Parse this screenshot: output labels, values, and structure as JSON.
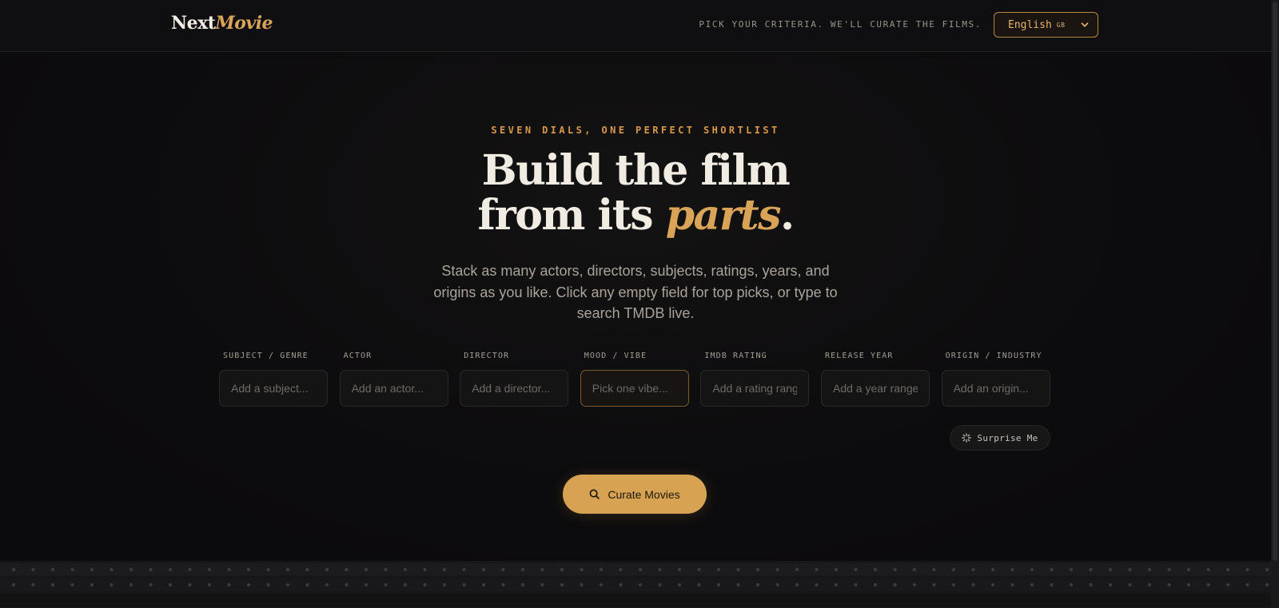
{
  "header": {
    "logo_main": "Next",
    "logo_accent": "Movie",
    "tagline": "PICK YOUR CRITERIA. WE'LL CURATE THE FILMS.",
    "language": {
      "selected": "English",
      "flag": "GB"
    }
  },
  "hero": {
    "eyebrow": "SEVEN DIALS, ONE PERFECT SHORTLIST",
    "headline_line1": "Build the film",
    "headline_line2_prefix": "from its ",
    "headline_accent": "parts",
    "headline_suffix": ".",
    "subtext": "Stack as many actors, directors, subjects, ratings, years, and origins as you like. Click any empty field for top picks, or type to search TMDB live."
  },
  "fields": [
    {
      "label": "SUBJECT / GENRE",
      "placeholder": "Add a subject...",
      "value": ""
    },
    {
      "label": "ACTOR",
      "placeholder": "Add an actor...",
      "value": ""
    },
    {
      "label": "DIRECTOR",
      "placeholder": "Add a director...",
      "value": ""
    },
    {
      "label": "MOOD / VIBE",
      "placeholder": "Pick one vibe...",
      "value": ""
    },
    {
      "label": "IMDB RATING",
      "placeholder": "Add a rating range...",
      "value": ""
    },
    {
      "label": "RELEASE YEAR",
      "placeholder": "Add a year range...",
      "value": ""
    },
    {
      "label": "ORIGIN / INDUSTRY",
      "placeholder": "Add an origin...",
      "value": ""
    }
  ],
  "actions": {
    "surprise_label": "Surprise Me",
    "curate_label": "Curate Movies"
  },
  "colors": {
    "accent": "#d9a457",
    "background": "#0c0b0d",
    "eyebrow": "#d9984a"
  },
  "icons": {
    "surprise": "sparkle-icon",
    "curate": "search-icon",
    "language": "chevron-down-icon"
  }
}
